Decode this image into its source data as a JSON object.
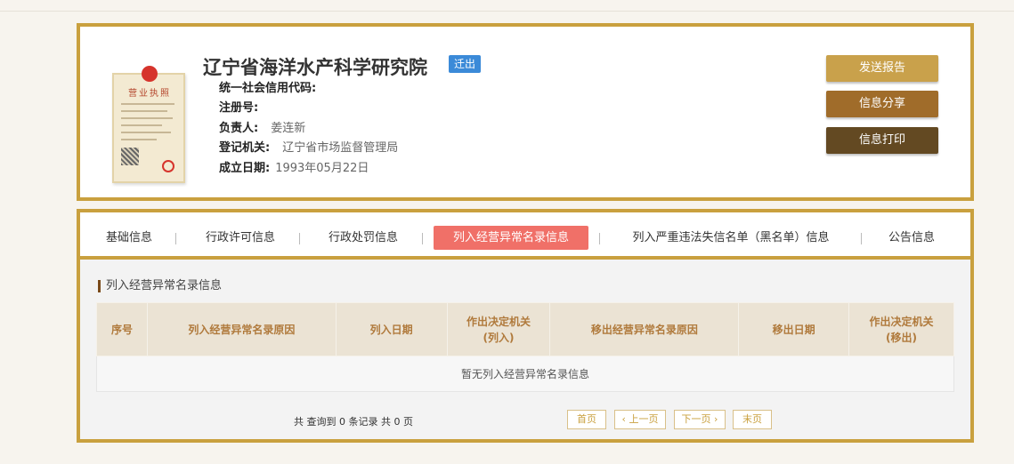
{
  "company": {
    "name": "辽宁省海洋水产科学研究院",
    "status_badge": "迁出",
    "license_title": "营业执照",
    "credit_code_label": "统一社会信用代码:",
    "credit_code_value": "",
    "reg_no_label": "注册号:",
    "reg_no_value": "",
    "legal_rep_label": "负责人:",
    "legal_rep_value": "姜连新",
    "authority_label": "登记机关:",
    "authority_value": "辽宁省市场监督管理局",
    "established_label": "成立日期:",
    "established_value": "1993年05月22日"
  },
  "actions": {
    "report": "发送报告",
    "share": "信息分享",
    "print": "信息打印"
  },
  "tabs": [
    {
      "label": "基础信息"
    },
    {
      "label": "行政许可信息"
    },
    {
      "label": "行政处罚信息"
    },
    {
      "label": "列入经营异常名录信息"
    },
    {
      "label": "列入严重违法失信名单（黑名单）信息"
    },
    {
      "label": "公告信息"
    }
  ],
  "active_tab": "列入经营异常名录信息",
  "section": {
    "title": "列入经营异常名录信息",
    "columns": [
      {
        "l1": "序号",
        "l2": ""
      },
      {
        "l1": "列入经营异常名录原因",
        "l2": ""
      },
      {
        "l1": "列入日期",
        "l2": ""
      },
      {
        "l1": "作出决定机关",
        "l2": "(列入)"
      },
      {
        "l1": "移出经营异常名录原因",
        "l2": ""
      },
      {
        "l1": "移出日期",
        "l2": ""
      },
      {
        "l1": "作出决定机关",
        "l2": "(移出)"
      }
    ],
    "empty_message": "暂无列入经营异常名录信息"
  },
  "pagination": {
    "summary": "共 查询到 0 条记录 共 0 页",
    "first": "首页",
    "prev": "上一页",
    "next": "下一页",
    "last": "末页"
  },
  "colors": {
    "accent": "#c9a03e",
    "active_tab": "#f07068",
    "badge": "#3b8ad8"
  }
}
